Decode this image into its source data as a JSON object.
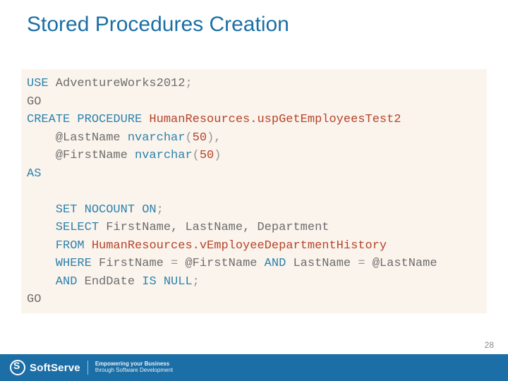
{
  "title": "Stored Procedures Creation",
  "code": {
    "l1_use": "USE",
    "l1_db": " AdventureWorks2012",
    "l1_sc": ";",
    "l2": "GO",
    "l3_cp": "CREATE PROCEDURE",
    "l3_proc": " HumanResources.uspGetEmployeesTest2",
    "l4_param": "    @LastName ",
    "l4_type": "nvarchar",
    "l4_open": "(",
    "l4_num": "50",
    "l4_close": "),",
    "l5_param": "    @FirstName ",
    "l5_type": "nvarchar",
    "l5_open": "(",
    "l5_num": "50",
    "l5_close": ")",
    "l6": "AS",
    "blank": "",
    "l8_set": "    SET NOCOUNT ON",
    "l8_sc": ";",
    "l9_sel": "    SELECT",
    "l9_cols": " FirstName, LastName, Department",
    "l10_from": "    FROM",
    "l10_tbl": " HumanResources.vEmployeeDepartmentHistory",
    "l11_where": "    WHERE",
    "l11_c1": " FirstName ",
    "l11_eq1": "=",
    "l11_p1": " @FirstName ",
    "l11_and": "AND",
    "l11_c2": " LastName ",
    "l11_eq2": "=",
    "l11_p2": " @LastName",
    "l12_and": "    AND",
    "l12_col": " EndDate ",
    "l12_is": "IS",
    "l12_sp": " ",
    "l12_null": "NULL",
    "l12_sc": ";",
    "l13": "GO"
  },
  "footer": {
    "brand": "SoftServe",
    "tagline1": "Empowering your Business",
    "tagline2": "through Software Development"
  },
  "page": "28"
}
